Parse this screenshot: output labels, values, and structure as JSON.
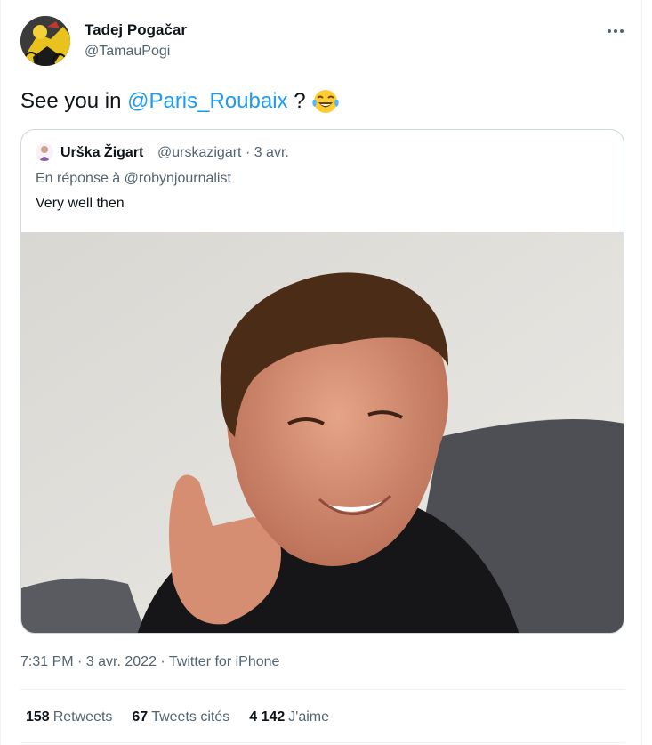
{
  "author": {
    "name": "Tadej Pogačar",
    "handle": "@TamauPogi"
  },
  "tweet": {
    "text_before": "See you in ",
    "mention": "@Paris_Roubaix",
    "text_after": " ?",
    "emoji": "face-with-tears-of-joy"
  },
  "quoted": {
    "name": "Urška Žigart",
    "handle": "@urskazigart · 3 avr.",
    "reply_to": "En réponse à @robynjournalist",
    "text": "Very well then",
    "photo_icon": "photo-man-pointing"
  },
  "meta": {
    "timestamp": "7:31 PM · 3 avr. 2022 · Twitter for iPhone"
  },
  "stats": {
    "retweets_count": "158",
    "retweets_label": "Retweets",
    "quotes_count": "67",
    "quotes_label": "Tweets cités",
    "likes_count": "4 142",
    "likes_label": "J'aime"
  },
  "colors": {
    "accent": "#1d9bf0",
    "secondary_text": "#536471",
    "border": "#cfd9de"
  }
}
